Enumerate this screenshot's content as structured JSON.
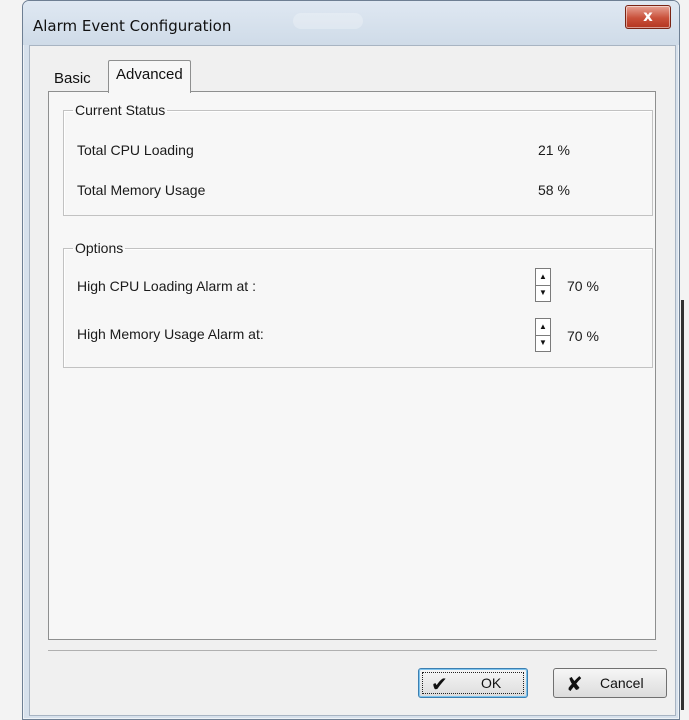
{
  "window": {
    "title": "Alarm Event Configuration",
    "close_glyph": "x"
  },
  "tabs": {
    "basic": "Basic",
    "advanced": "Advanced",
    "active": "Advanced"
  },
  "current_status": {
    "legend": "Current Status",
    "cpu_label": "Total CPU Loading",
    "cpu_value": "21 %",
    "memory_label": "Total Memory Usage",
    "memory_value": "58 %"
  },
  "options": {
    "legend": "Options",
    "cpu_alarm_label": "High CPU Loading Alarm at :",
    "cpu_alarm_value": "70 %",
    "memory_alarm_label": "High Memory Usage Alarm at:",
    "memory_alarm_value": "70 %"
  },
  "buttons": {
    "ok_label": "OK",
    "ok_icon": "checkmark-icon",
    "cancel_label": "Cancel",
    "cancel_icon": "x-icon"
  },
  "colors": {
    "close_button": "#c9503a",
    "ok_focus_border": "#3c7fb1"
  }
}
